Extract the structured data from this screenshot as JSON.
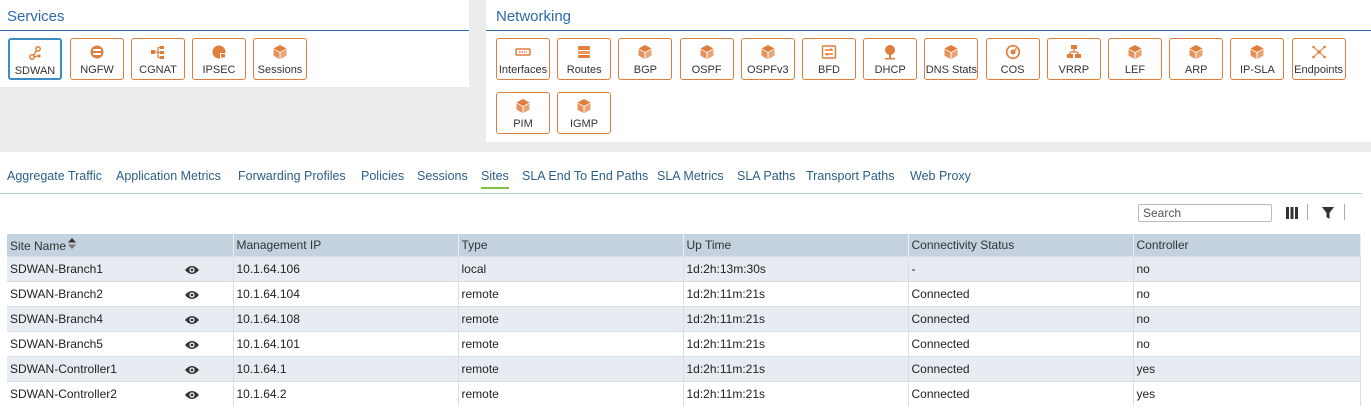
{
  "services": {
    "title": "Services",
    "tiles": [
      {
        "label": "SDWAN",
        "icon": "sdwan-icon"
      },
      {
        "label": "NGFW",
        "icon": "firewall-icon"
      },
      {
        "label": "CGNAT",
        "icon": "cgnat-icon"
      },
      {
        "label": "IPSEC",
        "icon": "ipsec-icon"
      },
      {
        "label": "Sessions",
        "icon": "cube-icon"
      }
    ]
  },
  "networking": {
    "title": "Networking",
    "tiles": [
      {
        "label": "Interfaces",
        "icon": "interfaces-icon"
      },
      {
        "label": "Routes",
        "icon": "routes-icon"
      },
      {
        "label": "BGP",
        "icon": "cube-icon"
      },
      {
        "label": "OSPF",
        "icon": "cube-icon"
      },
      {
        "label": "OSPFv3",
        "icon": "cube-icon"
      },
      {
        "label": "BFD",
        "icon": "bfd-icon"
      },
      {
        "label": "DHCP",
        "icon": "dhcp-icon"
      },
      {
        "label": "DNS Stats",
        "icon": "cube-icon"
      },
      {
        "label": "COS",
        "icon": "cos-icon"
      },
      {
        "label": "VRRP",
        "icon": "vrrp-icon"
      },
      {
        "label": "LEF",
        "icon": "cube-icon"
      },
      {
        "label": "ARP",
        "icon": "cube-icon"
      },
      {
        "label": "IP-SLA",
        "icon": "cube-icon"
      },
      {
        "label": "Endpoints",
        "icon": "endpoints-icon"
      },
      {
        "label": "PIM",
        "icon": "cube-icon"
      },
      {
        "label": "IGMP",
        "icon": "cube-icon"
      }
    ]
  },
  "tabs": [
    "Aggregate Traffic",
    "Application Metrics",
    "Forwarding Profiles",
    "Policies",
    "Sessions",
    "Sites",
    "SLA End To End Paths",
    "SLA Metrics",
    "SLA Paths",
    "Transport Paths",
    "Web Proxy"
  ],
  "active_tab": "Sites",
  "search": {
    "placeholder": "Search"
  },
  "table": {
    "columns": [
      "Site Name",
      "Management IP",
      "Type",
      "Up Time",
      "Connectivity Status",
      "Controller"
    ],
    "rows": [
      [
        "SDWAN-Branch1",
        "10.1.64.106",
        "local",
        "1d:2h:13m:30s",
        "-",
        "no"
      ],
      [
        "SDWAN-Branch2",
        "10.1.64.104",
        "remote",
        "1d:2h:11m:21s",
        "Connected",
        "no"
      ],
      [
        "SDWAN-Branch4",
        "10.1.64.108",
        "remote",
        "1d:2h:11m:21s",
        "Connected",
        "no"
      ],
      [
        "SDWAN-Branch5",
        "10.1.64.101",
        "remote",
        "1d:2h:11m:21s",
        "Connected",
        "no"
      ],
      [
        "SDWAN-Controller1",
        "10.1.64.1",
        "remote",
        "1d:2h:11m:21s",
        "Connected",
        "yes"
      ],
      [
        "SDWAN-Controller2",
        "10.1.64.2",
        "remote",
        "1d:2h:11m:21s",
        "Connected",
        "yes"
      ]
    ]
  },
  "colors": {
    "accent": "#2c6aa8",
    "tile_border": "#e07e3c",
    "icon_orange": "#e07e3c",
    "header_bg": "#c3d2de",
    "active_tab": "#7cc442"
  }
}
